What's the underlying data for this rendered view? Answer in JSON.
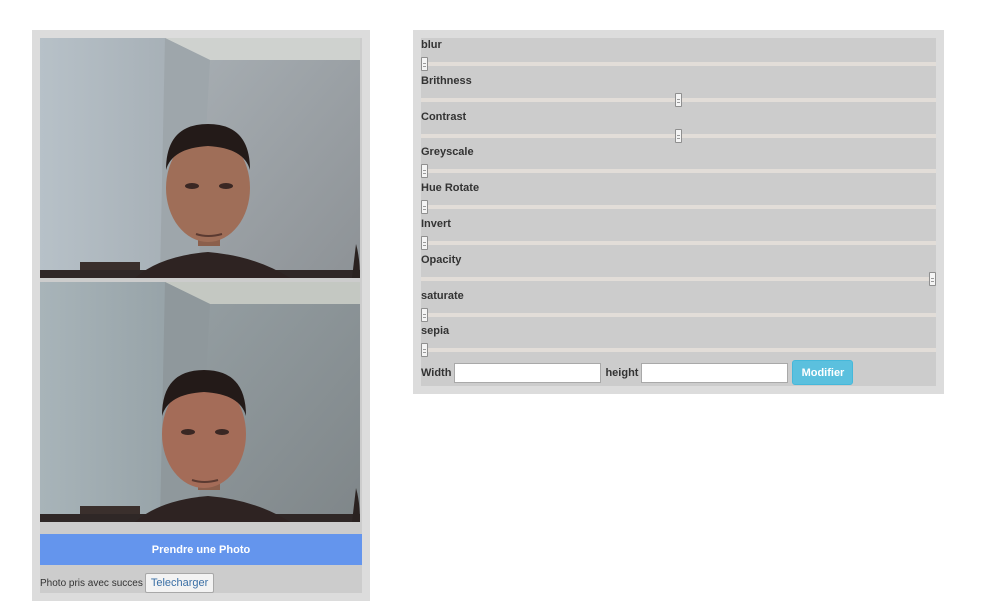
{
  "camera": {
    "take_photo_label": "Prendre une Photo",
    "status_text": "Photo pris avec succes",
    "download_label": "Telecharger",
    "frames": [
      "live-video-feed",
      "captured-photo"
    ]
  },
  "filters": {
    "items": [
      {
        "label": "blur",
        "value": 0
      },
      {
        "label": "Brithness",
        "value": 0.5
      },
      {
        "label": "Contrast",
        "value": 0.5
      },
      {
        "label": "Greyscale",
        "value": 0
      },
      {
        "label": "Hue Rotate",
        "value": 0
      },
      {
        "label": "Invert",
        "value": 0
      },
      {
        "label": "Opacity",
        "value": 1
      },
      {
        "label": "saturate",
        "value": 0
      },
      {
        "label": "sepia",
        "value": 0
      }
    ]
  },
  "size": {
    "width_label": "Width",
    "width_value": "",
    "height_label": "height",
    "height_value": "",
    "modify_label": "Modifier"
  },
  "colors": {
    "primary_button": "#6495ed",
    "info_button": "#5bc0de",
    "panel": "#dcdcdc",
    "panel_inner": "#cccccc"
  }
}
